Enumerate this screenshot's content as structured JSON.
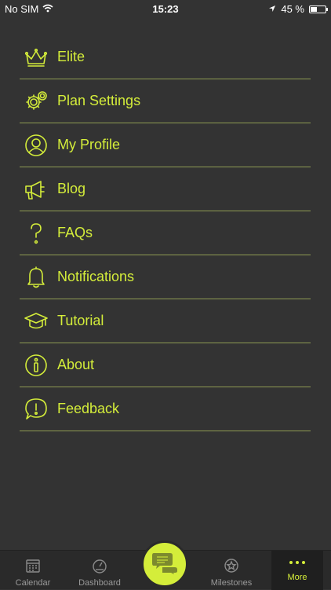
{
  "status_bar": {
    "carrier": "No SIM",
    "time": "15:23",
    "battery": "45 %",
    "battery_level": 0.45
  },
  "menu": {
    "items": [
      {
        "label": "Elite",
        "icon": "crown-icon"
      },
      {
        "label": "Plan Settings",
        "icon": "gears-icon"
      },
      {
        "label": "My Profile",
        "icon": "profile-icon"
      },
      {
        "label": "Blog",
        "icon": "megaphone-icon"
      },
      {
        "label": "FAQs",
        "icon": "question-icon"
      },
      {
        "label": "Notifications",
        "icon": "bell-icon"
      },
      {
        "label": "Tutorial",
        "icon": "graduation-cap-icon"
      },
      {
        "label": "About",
        "icon": "info-icon"
      },
      {
        "label": "Feedback",
        "icon": "exclamation-bubble-icon"
      }
    ]
  },
  "tab_bar": {
    "tabs": [
      {
        "label": "Calendar",
        "icon": "calendar-icon"
      },
      {
        "label": "Dashboard",
        "icon": "gauge-icon"
      },
      {
        "label": "Milestones",
        "icon": "star-badge-icon"
      },
      {
        "label": "More",
        "icon": "more-dots-icon",
        "active": true
      }
    ],
    "center_button_icon": "chat-bubbles-icon"
  },
  "colors": {
    "accent": "#d4ed3a",
    "background": "#333333",
    "tab_bar": "#2a2a2a",
    "divider": "#8e9a52"
  }
}
